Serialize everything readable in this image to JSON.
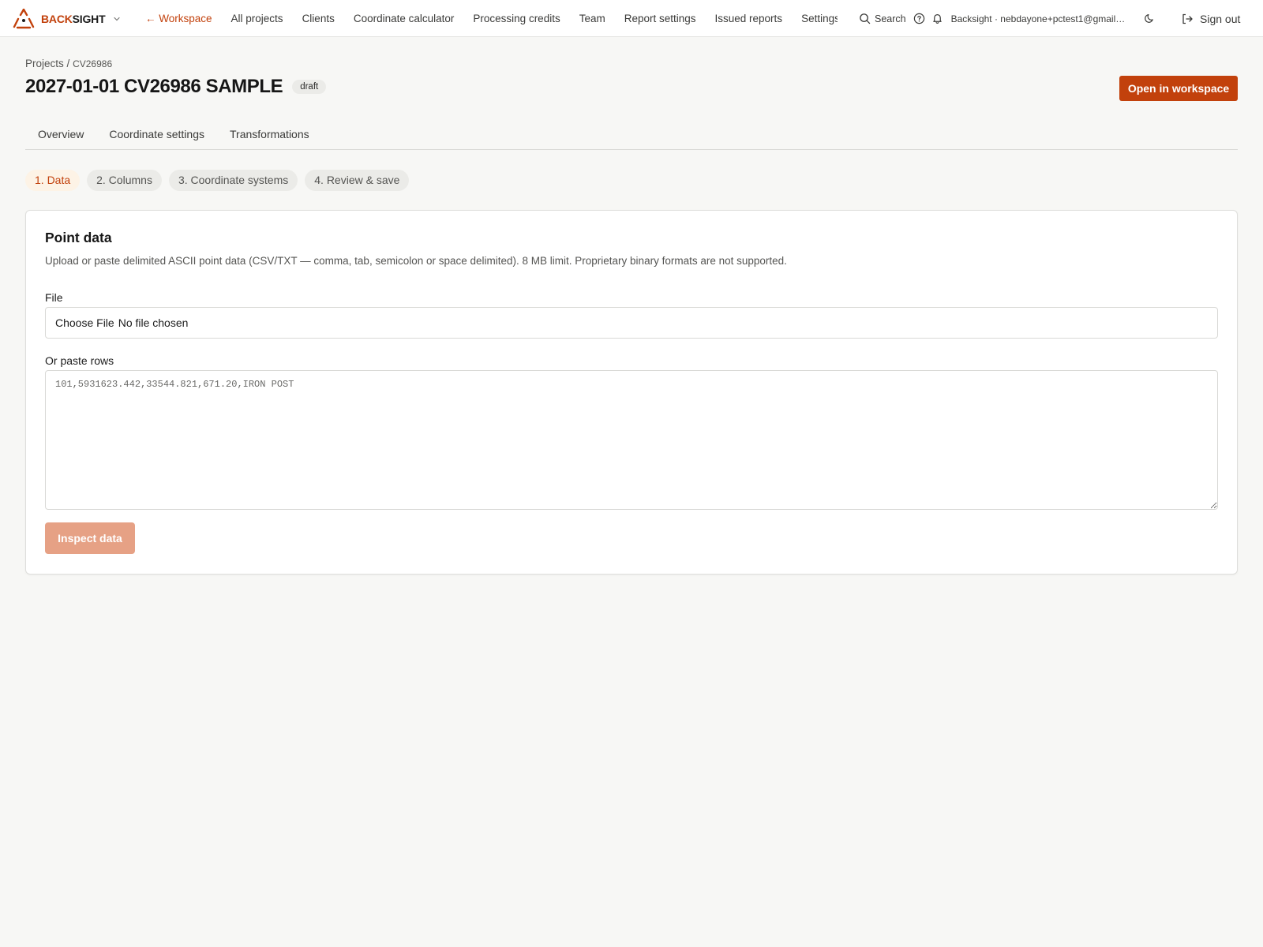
{
  "brand": {
    "name_accent": "BACK",
    "name_rest": "SIGHT",
    "accent_color": "#c2410c",
    "logo_icon": "triangle-logo-icon",
    "menu_icon": "chevron-down-icon"
  },
  "nav": {
    "back_label": "← Workspace",
    "items": [
      "All projects",
      "Clients",
      "Coordinate calculator",
      "Processing credits",
      "Team",
      "Report settings",
      "Issued reports",
      "Settings"
    ]
  },
  "header_right": {
    "search_label": "Search",
    "account_label": "Backsight · nebdayone+pctest1@gmail.com",
    "sign_out_label": "Sign out"
  },
  "breadcrumb": {
    "root": "Projects",
    "separator": "/",
    "current": "CV26986"
  },
  "page": {
    "title": "2027-01-01 CV26986 SAMPLE",
    "status_badge": "draft",
    "open_workspace_label": "Open in workspace"
  },
  "tabs": [
    "Overview",
    "Coordinate settings",
    "Transformations"
  ],
  "steps": {
    "active_index": 0,
    "items": [
      "1. Data",
      "2. Columns",
      "3. Coordinate systems",
      "4. Review & save"
    ]
  },
  "card": {
    "title": "Point data",
    "description": "Upload or paste delimited ASCII point data (CSV/TXT — comma, tab, semicolon or space delimited). 8 MB limit. Proprietary binary formats are not supported.",
    "file_label": "File",
    "file_choose": "Choose File",
    "file_status": "No file chosen",
    "paste_label": "Or paste rows",
    "paste_placeholder": "101,5931623.442,33544.821,671.20,IRON POST",
    "inspect_label": "Inspect data",
    "inspect_enabled": false
  }
}
